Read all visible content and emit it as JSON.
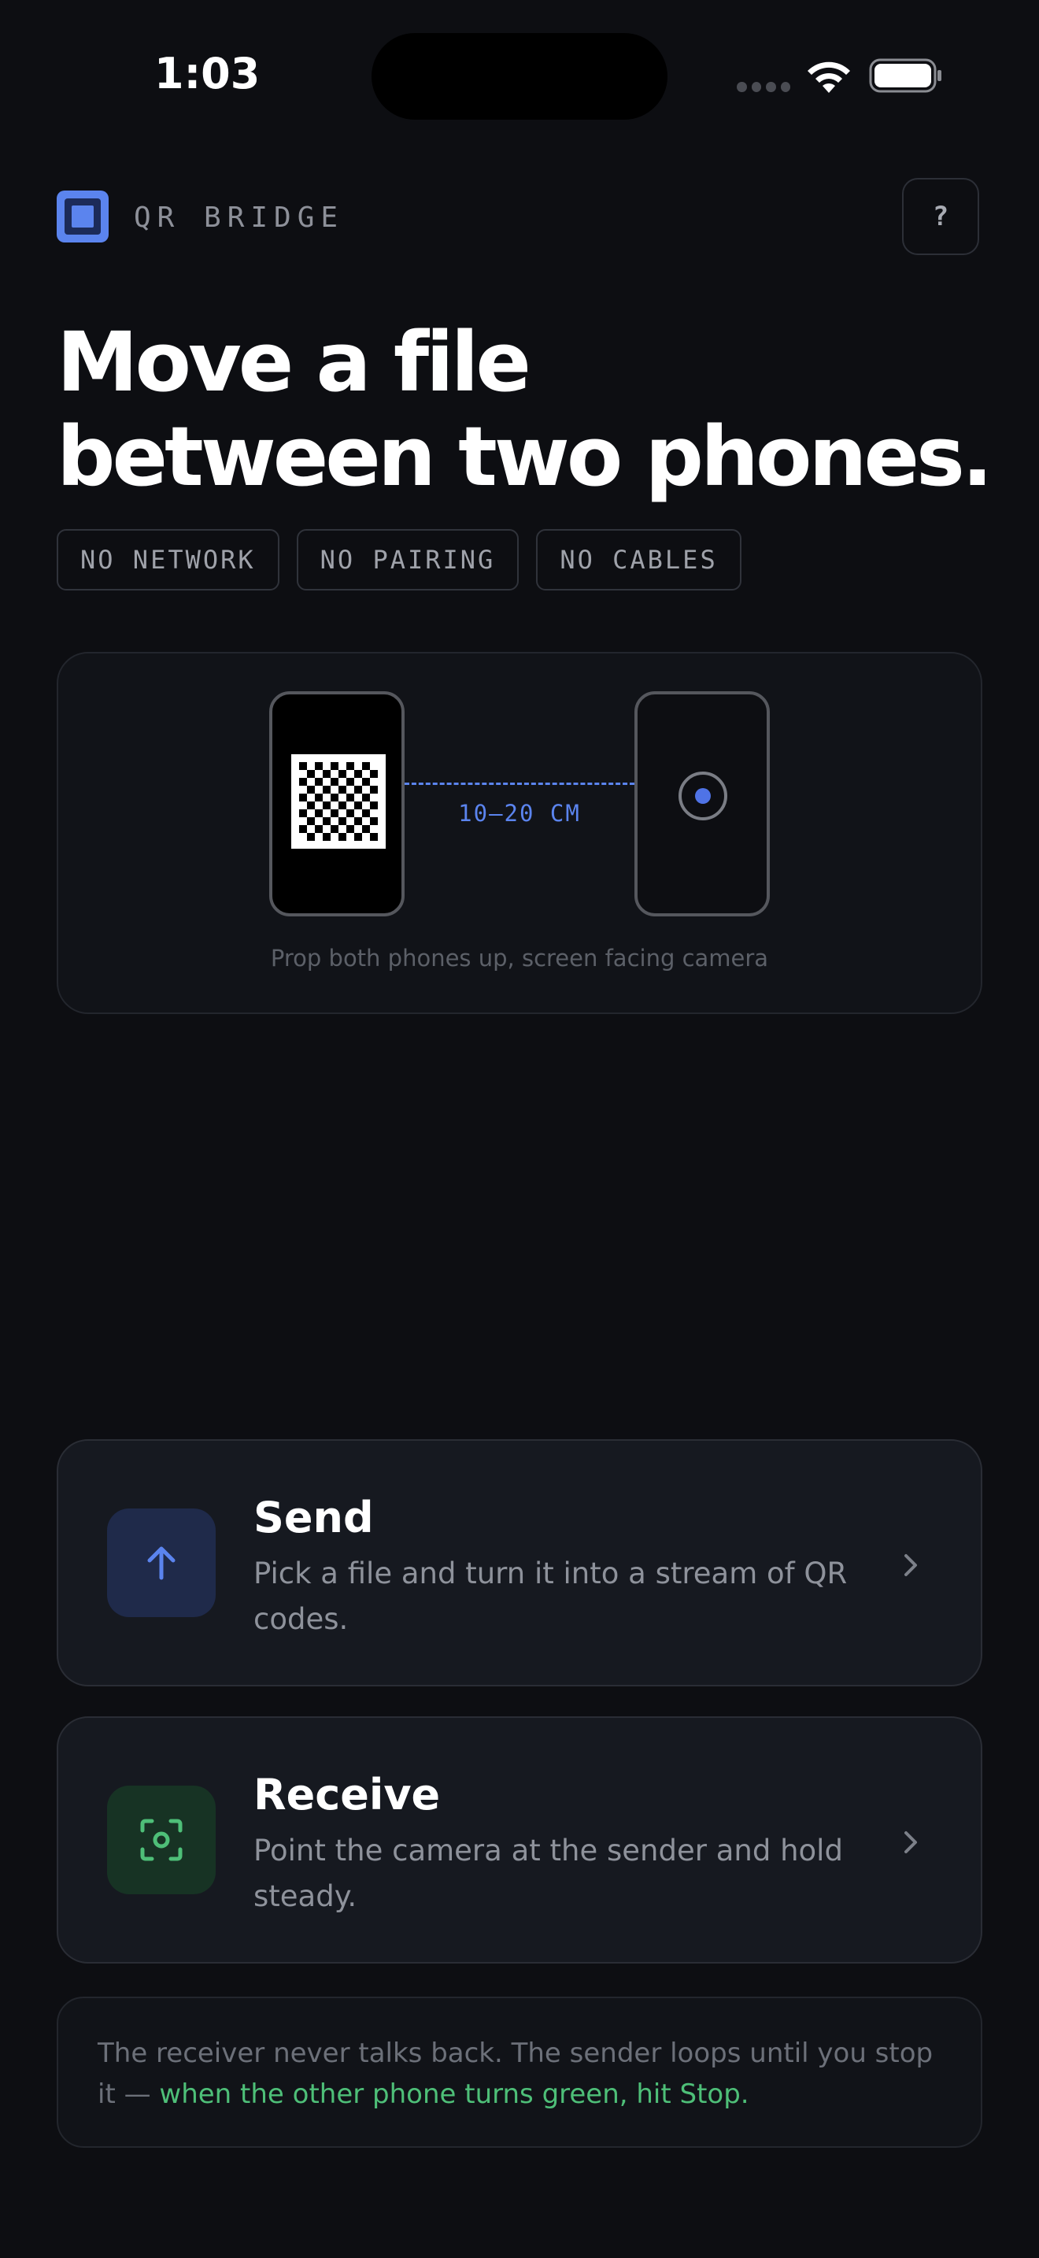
{
  "status_bar": {
    "time": "1:03",
    "icons": [
      "signal-icon",
      "wifi-icon",
      "battery-icon"
    ]
  },
  "header": {
    "app_name": "QR BRIDGE",
    "help_label": "?"
  },
  "hero": {
    "headline_line1": "Move a file",
    "headline_line2": "between two phones.",
    "tags": [
      "NO NETWORK",
      "NO PAIRING",
      "NO CABLES"
    ]
  },
  "illustration": {
    "distance_label": "10–20 CM",
    "caption": "Prop both phones up, screen facing camera"
  },
  "actions": {
    "send": {
      "title": "Send",
      "description": "Pick a file and turn it into a stream of QR codes.",
      "icon": "arrow-up-icon"
    },
    "receive": {
      "title": "Receive",
      "description": "Point the camera at the sender and hold steady.",
      "icon": "scan-icon"
    }
  },
  "note": {
    "text": "The receiver never talks back. The sender loops until you stop it — ",
    "highlight": "when the other phone turns green, hit Stop."
  },
  "colors": {
    "background": "#0d0e12",
    "accent_blue": "#5b84ee",
    "accent_green": "#4ebf78",
    "card": "#161920"
  }
}
